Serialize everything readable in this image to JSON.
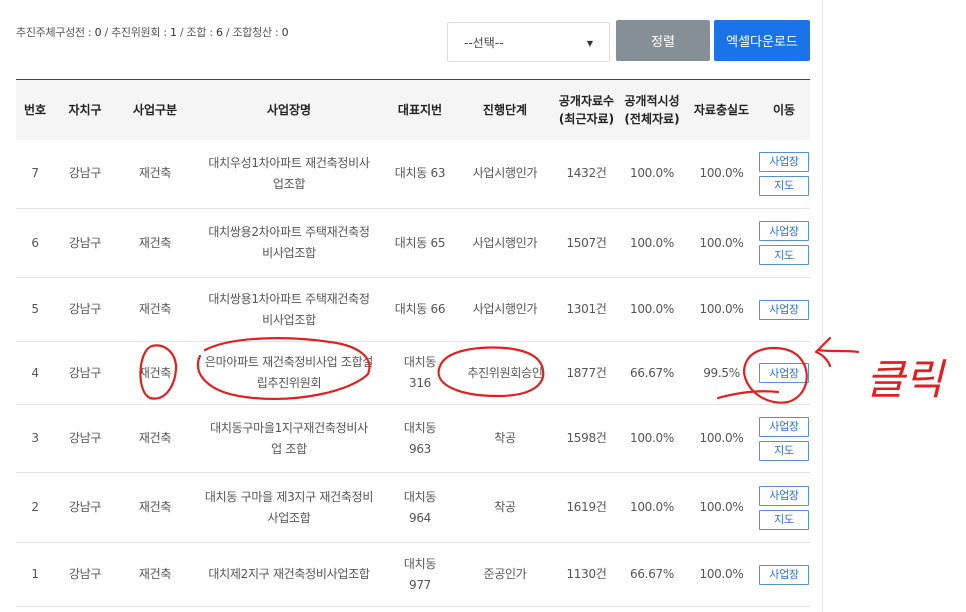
{
  "summary": [
    {
      "label": "추진주체구성전",
      "value": "0"
    },
    {
      "label": "추진위원회",
      "value": "1"
    },
    {
      "label": "조합",
      "value": "6"
    },
    {
      "label": "조합청산",
      "value": "0"
    }
  ],
  "filter": {
    "selected": "--선택--"
  },
  "buttons": {
    "sort": "정렬",
    "excel": "엑셀다운로드"
  },
  "headers": [
    "번호",
    "자치구",
    "사업구분",
    "사업장명",
    "대표지번",
    "진행단계",
    "공개자료수\n(최근자료)",
    "공개적시성\n(전체자료)",
    "자료충실도",
    "이동"
  ],
  "rows": [
    {
      "no": "7",
      "district": "강남구",
      "type": "재건축",
      "name": "대치우성1차아파트 재건축정비사\n업조합",
      "lot": "대치동 63",
      "stage": "사업시행인가",
      "count": "1432건",
      "timeliness": "100.0%",
      "fidelity": "100.0%",
      "actions": [
        "사업장",
        "지도"
      ]
    },
    {
      "no": "6",
      "district": "강남구",
      "type": "재건축",
      "name": "대치쌍용2차아파트 주택재건축정\n비사업조합",
      "lot": "대치동 65",
      "stage": "사업시행인가",
      "count": "1507건",
      "timeliness": "100.0%",
      "fidelity": "100.0%",
      "actions": [
        "사업장",
        "지도"
      ]
    },
    {
      "no": "5",
      "district": "강남구",
      "type": "재건축",
      "name": "대치쌍용1차아파트 주택재건축정\n비사업조합",
      "lot": "대치동 66",
      "stage": "사업시행인가",
      "count": "1301건",
      "timeliness": "100.0%",
      "fidelity": "100.0%",
      "actions": [
        "사업장"
      ]
    },
    {
      "no": "4",
      "district": "강남구",
      "type": "재건축",
      "name": "은마아파트 재건축정비사업 조합설\n립추진위원회",
      "lot": "대치동\n316",
      "stage": "추진위원회승인",
      "count": "1877건",
      "timeliness": "66.67%",
      "fidelity": "99.5%",
      "actions": [
        "사업장"
      ]
    },
    {
      "no": "3",
      "district": "강남구",
      "type": "재건축",
      "name": "대치동구마을1지구재건축정비사\n업 조합",
      "lot": "대치동\n963",
      "stage": "착공",
      "count": "1598건",
      "timeliness": "100.0%",
      "fidelity": "100.0%",
      "actions": [
        "사업장",
        "지도"
      ]
    },
    {
      "no": "2",
      "district": "강남구",
      "type": "재건축",
      "name": "대치동 구마을 제3지구 재건축정비\n사업조합",
      "lot": "대치동\n964",
      "stage": "착공",
      "count": "1619건",
      "timeliness": "100.0%",
      "fidelity": "100.0%",
      "actions": [
        "사업장",
        "지도"
      ]
    },
    {
      "no": "1",
      "district": "강남구",
      "type": "재건축",
      "name": "대치제2지구 재건축정비사업조합",
      "lot": "대치동\n977",
      "stage": "준공인가",
      "count": "1130건",
      "timeliness": "66.67%",
      "fidelity": "100.0%",
      "actions": [
        "사업장"
      ]
    }
  ],
  "annotation": {
    "text": "클릭",
    "color": "#e02020"
  }
}
